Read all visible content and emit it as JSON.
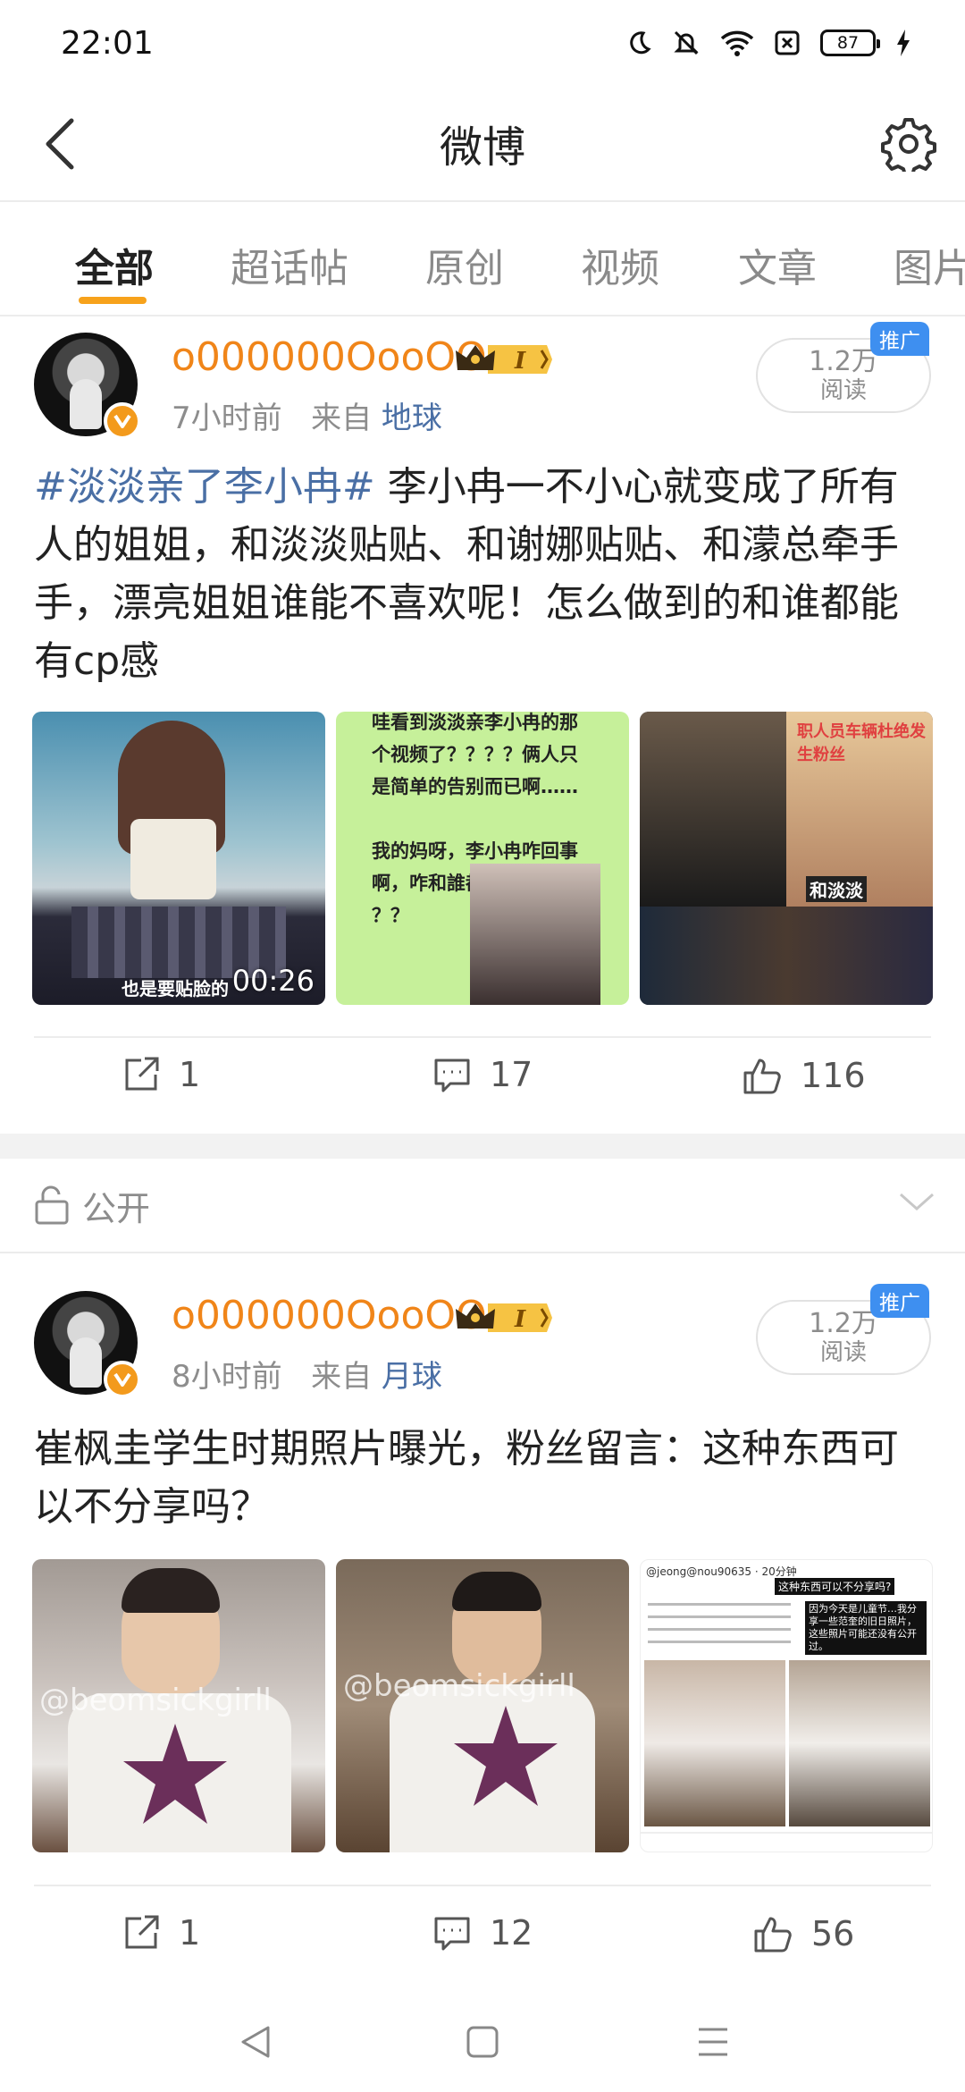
{
  "status_bar": {
    "time": "22:01",
    "battery": "87",
    "icons": [
      "moon-icon",
      "bell-off-icon",
      "wifi-icon",
      "sim-off-icon",
      "battery-icon",
      "charging-icon"
    ]
  },
  "header": {
    "title": "微博",
    "back_icon": "back-chevron-icon",
    "settings_icon": "gear-icon"
  },
  "tabs": [
    {
      "label": "全部",
      "active": true
    },
    {
      "label": "超话帖",
      "active": false
    },
    {
      "label": "原创",
      "active": false
    },
    {
      "label": "视频",
      "active": false
    },
    {
      "label": "文章",
      "active": false
    },
    {
      "label": "图片",
      "active": false
    }
  ],
  "posts": [
    {
      "username": "o000000OooOO",
      "meta_time": "7小时前",
      "meta_from": "来自",
      "meta_source": "地球",
      "read_count": "1.2万",
      "read_label": "阅读",
      "promo_tag": "推广",
      "hashtag": "#淡淡亲了李小冉#",
      "text": " 李小冉一不小心就变成了所有人的姐姐，和淡淡贴贴、和谢娜贴贴、和濛总牵手手，漂亮姐姐谁能不喜欢呢！怎么做到的和谁都能有cp感",
      "images": [
        {
          "caption": "也是要贴脸的",
          "duration": "00:26"
        },
        {
          "lines": [
            "哇看到淡淡亲李小冉的那",
            "个视频了？？？？俩人只",
            "是简单的告别而已啊……",
            "",
            "我的妈呀，李小冉咋回事",
            "啊，咋和誰都有cp感呢？",
            "？？"
          ]
        },
        {
          "top_text": "职人员车辆杜绝发生粉丝",
          "sign_text": "和淡淡"
        }
      ],
      "actions": {
        "share": "1",
        "comment": "17",
        "like": "116"
      }
    },
    {
      "username": "o000000OooOO",
      "meta_time": "8小时前",
      "meta_from": "来自",
      "meta_source": "月球",
      "read_count": "1.2万",
      "read_label": "阅读",
      "promo_tag": "推广",
      "text": "崔枫圭学生时期照片曝光，粉丝留言：这种东西可以不分享吗？",
      "images": [
        {
          "watermark": "@beomsickgirll"
        },
        {
          "watermark": "@beomsickgirll"
        },
        {
          "header_handle": "@jeong@nou90635 · 20分钟",
          "quote": "这种东西可以不分享吗?",
          "note": "因为今天是儿童节…我分享一些范奎的旧日照片，这些照片可能还没有公开过。"
        }
      ],
      "actions": {
        "share": "1",
        "comment": "12",
        "like": "56"
      }
    }
  ],
  "public_bar": {
    "label": "公开",
    "icon": "unlock-icon"
  },
  "nav_bar": {
    "back_icon": "triangle-back-icon",
    "home_icon": "square-home-icon",
    "menu_icon": "menu-lines-icon"
  },
  "colors": {
    "accent_orange": "#f08519",
    "link_blue": "#4a6fa5",
    "promo_blue": "#3e8ff0",
    "tab_indicator": "#f7a21b"
  }
}
